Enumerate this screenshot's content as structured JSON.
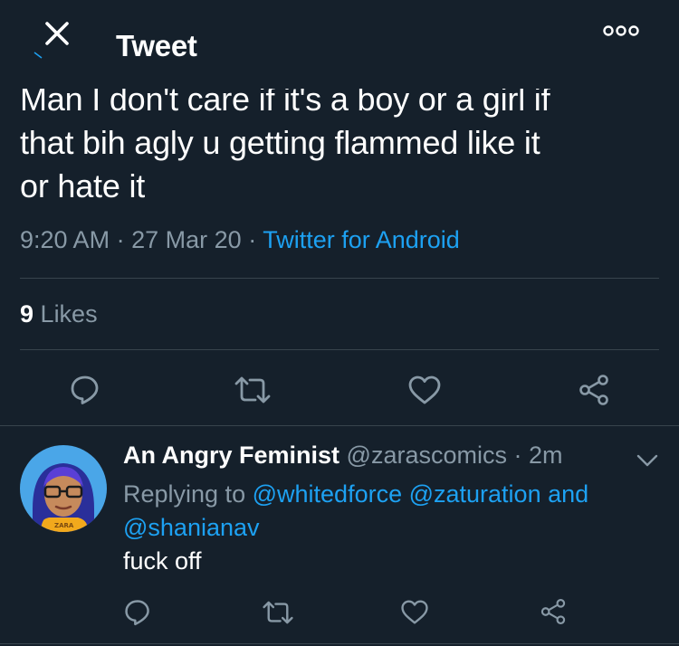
{
  "header": {
    "title": "Tweet",
    "close_icon": "close-icon",
    "more_icon": "more-options-icon"
  },
  "tweet": {
    "text": "Man I don't care if it's a boy or a girl if\nthat bih agly u getting flammed like it\nor hate it",
    "time": "9:20 AM",
    "sep1": "·",
    "date": "27 Mar 20",
    "sep2": "·",
    "source": "Twitter for Android",
    "likes_count": "9",
    "likes_label": "Likes",
    "actions": [
      "reply-icon",
      "retweet-icon",
      "like-icon",
      "share-icon"
    ]
  },
  "reply": {
    "display_name": "An Angry Feminist",
    "handle": "@zarascomics",
    "sep": "·",
    "time_ago": "2m",
    "replying_prefix": "Replying to",
    "mention1": "@whitedforce",
    "mention2": "@zaturation",
    "and_word": "and",
    "mention3": "@shanianav",
    "text": "fuck off",
    "avatar_badge": "ZARA",
    "actions": [
      "reply-icon",
      "retweet-icon",
      "like-icon",
      "share-icon"
    ]
  },
  "colors": {
    "background": "#15202b",
    "accent": "#1da1f2",
    "secondary_text": "#8899a6",
    "divider": "#38444d"
  }
}
